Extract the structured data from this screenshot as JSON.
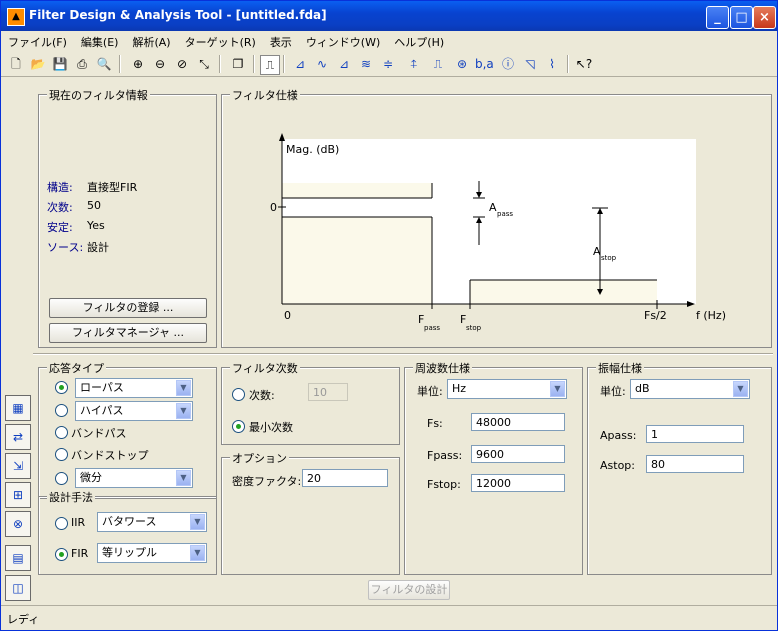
{
  "window": {
    "title": "Filter Design & Analysis Tool - [untitled.fda]",
    "minimize": "_",
    "maximize": "□",
    "close": "×"
  },
  "menu": [
    "ファイル(F)",
    "編集(E)",
    "解析(A)",
    "ターゲット(R)",
    "表示",
    "ウィンドウ(W)",
    "ヘルプ(H)"
  ],
  "current_info": {
    "title": "現在のフィルタ情報",
    "rows": [
      {
        "key": "構造:",
        "value": "直接型FIR"
      },
      {
        "key": "次数:",
        "value": "50"
      },
      {
        "key": "安定:",
        "value": "Yes"
      },
      {
        "key": "ソース:",
        "value": "設計"
      }
    ],
    "register_btn": "フィルタの登録 ...",
    "manager_btn": "フィルタマネージャ ..."
  },
  "spec": {
    "title": "フィルタ仕様",
    "mag_label": "Mag. (dB)",
    "zero_y": "0",
    "zero_x": "0",
    "a_pass": "A",
    "a_pass_sub": "pass",
    "a_stop": "A",
    "a_stop_sub": "stop",
    "f_pass": "F",
    "f_pass_sub": "pass",
    "f_stop": "F",
    "f_stop_sub": "stop",
    "fs2": "Fs/2",
    "f_hz": "f (Hz)"
  },
  "response": {
    "title": "応答タイプ",
    "items": [
      {
        "label": "ローパス",
        "checked": true,
        "has_select": true
      },
      {
        "label": "ハイパス",
        "checked": false,
        "has_select": true
      },
      {
        "label": "バンドパス",
        "checked": false,
        "has_select": false
      },
      {
        "label": "バンドストップ",
        "checked": false,
        "has_select": false
      },
      {
        "label": "微分",
        "checked": false,
        "has_select": true
      }
    ]
  },
  "design_method": {
    "title": "設計手法",
    "iir_label": "IIR",
    "iir_value": "バタワース",
    "fir_label": "FIR",
    "fir_value": "等リップル"
  },
  "order": {
    "title": "フィルタ次数",
    "specify_label": "次数:",
    "specify_value": "10",
    "min_label": "最小次数"
  },
  "options": {
    "title": "オプション",
    "density_label": "密度ファクタ:",
    "density_value": "20"
  },
  "freq": {
    "title": "周波数仕様",
    "unit_label": "単位:",
    "unit_value": "Hz",
    "fs_label": "Fs:",
    "fs_value": "48000",
    "fpass_label": "Fpass:",
    "fpass_value": "9600",
    "fstop_label": "Fstop:",
    "fstop_value": "12000"
  },
  "mag": {
    "title": "振幅仕様",
    "unit_label": "単位:",
    "unit_value": "dB",
    "apass_label": "Apass:",
    "apass_value": "1",
    "astop_label": "Astop:",
    "astop_value": "80"
  },
  "design_btn": "フィルタの設計",
  "status": "レディ"
}
